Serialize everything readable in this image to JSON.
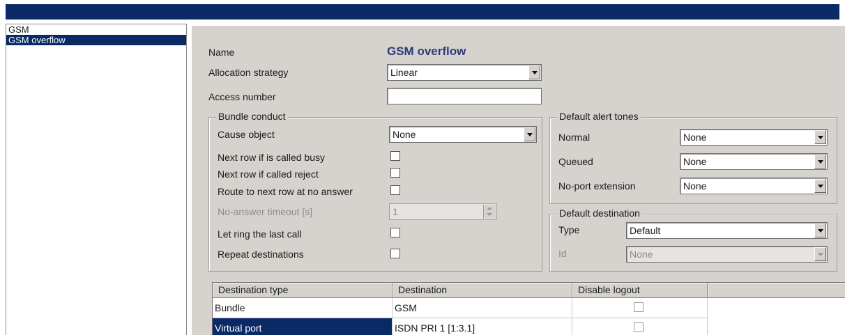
{
  "tree": {
    "items": [
      {
        "label": "GSM",
        "selected": false
      },
      {
        "label": "GSM overflow",
        "selected": true
      }
    ]
  },
  "form": {
    "name_label": "Name",
    "name_value": "GSM overflow",
    "allocation_label": "Allocation strategy",
    "allocation_value": "Linear",
    "access_label": "Access number",
    "access_value": ""
  },
  "bundle_conduct": {
    "title": "Bundle conduct",
    "cause_label": "Cause object",
    "cause_value": "None",
    "next_busy_label": "Next row if is called busy",
    "next_reject_label": "Next row if called reject",
    "route_noanswer_label": "Route to next row at no answer",
    "timeout_label": "No-answer timeout [s]",
    "timeout_value": "1",
    "ring_last_label": "Let ring the last call",
    "repeat_label": "Repeat destinations"
  },
  "alert_tones": {
    "title": "Default alert tones",
    "normal_label": "Normal",
    "normal_value": "None",
    "queued_label": "Queued",
    "queued_value": "None",
    "noport_label": "No-port extension",
    "noport_value": "None"
  },
  "default_destination": {
    "title": "Default destination",
    "type_label": "Type",
    "type_value": "Default",
    "id_label": "Id",
    "id_value": "None"
  },
  "grid": {
    "headers": [
      "Destination type",
      "Destination",
      "Disable logout"
    ],
    "rows": [
      {
        "type": "Bundle",
        "destination": "GSM",
        "selected": false
      },
      {
        "type": "Virtual port",
        "destination": "ISDN PRI 1 [1:3.1]",
        "selected": true
      }
    ]
  },
  "colors": {
    "title_bar": "#0a2a66",
    "selection": "#0a2a66",
    "dialog_bg": "#d6d3ce",
    "name_text": "#2b3a7a"
  }
}
